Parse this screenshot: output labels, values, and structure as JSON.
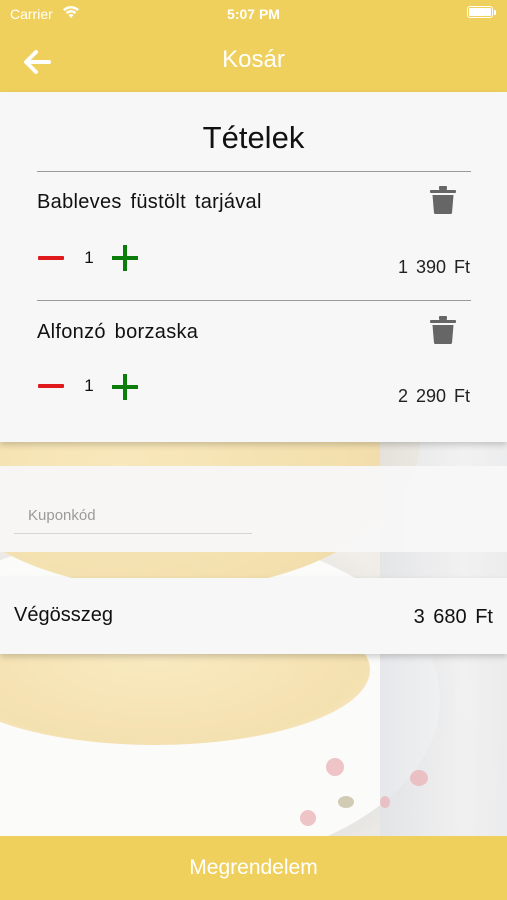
{
  "status_bar": {
    "carrier": "Carrier",
    "time": "5:07 PM"
  },
  "nav": {
    "title": "Kosár",
    "back_icon": "arrow-left-icon"
  },
  "cart": {
    "heading": "Tételek",
    "items": [
      {
        "name": "Bableves füstölt tarjával",
        "quantity": "1",
        "price": "1 390 Ft"
      },
      {
        "name": "Alfonzó borzaska",
        "quantity": "1",
        "price": "2 290 Ft"
      }
    ]
  },
  "coupon": {
    "placeholder": "Kuponkód",
    "value": ""
  },
  "summary": {
    "label": "Végösszeg",
    "total": "3 680 Ft"
  },
  "order_button": {
    "label": "Megrendelem"
  },
  "colors": {
    "accent": "#efd05c",
    "minus": "#e0191a",
    "plus": "#0a7d0a",
    "trash": "#666666"
  }
}
